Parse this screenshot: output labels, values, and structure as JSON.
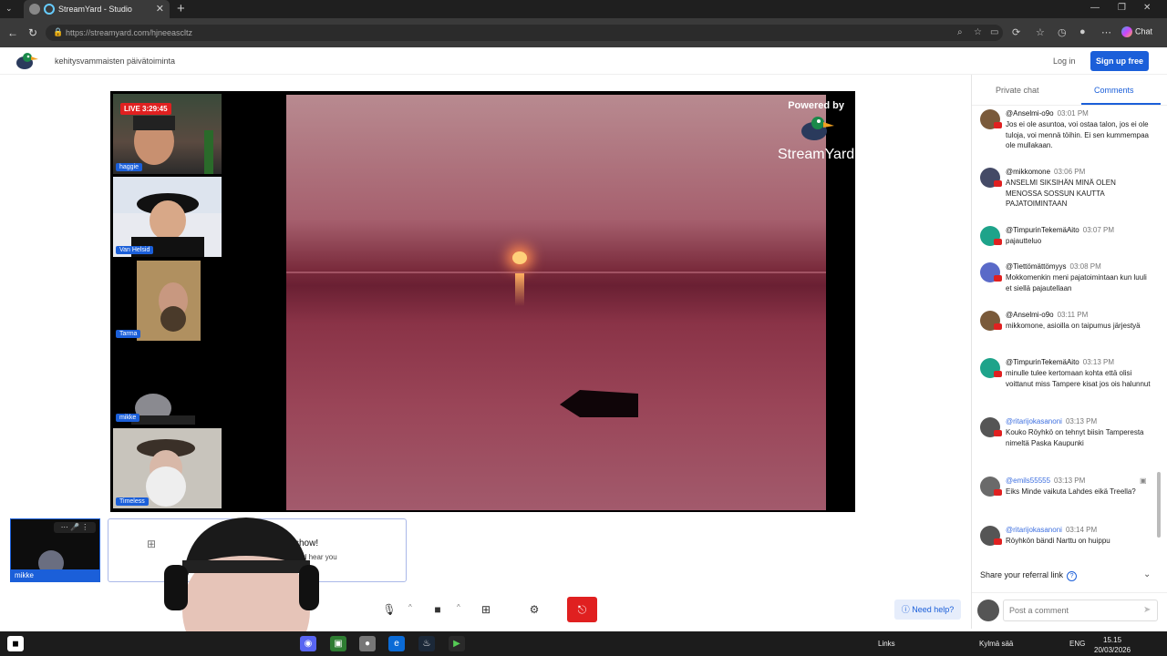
{
  "browser": {
    "tab_title": "StreamYard - Studio",
    "url": "https://streamyard.com/hjneeascltz",
    "chat_label": "Chat"
  },
  "header": {
    "title": "kehitysvammaisten päivätoiminta",
    "login": "Log in",
    "signup": "Sign up free"
  },
  "stage": {
    "live_badge": "LIVE 3:29:45",
    "cams": [
      {
        "name": "haggie"
      },
      {
        "name": "Van Helsid"
      },
      {
        "name": "Tarma"
      },
      {
        "name": "mikke"
      },
      {
        "name": "Timeless"
      }
    ],
    "powered_by": "Powered by",
    "brand": "StreamYard"
  },
  "selfcam": {
    "name": "mikke"
  },
  "prompt": {
    "title": "show!",
    "subtitle": "and hear you"
  },
  "controls": {
    "help": "Need help?"
  },
  "chat": {
    "tabs": [
      "Private chat",
      "Comments"
    ],
    "messages": [
      {
        "author": "@Anselmi-o9o",
        "time": "03:01 PM",
        "text": "Jos ei ole asuntoa, voi ostaa talon, jos ei ole tuloja, voi mennä töihin. Ei sen kummempaa ole mullakaan.",
        "avatar": "#7a5a3a",
        "mod": false
      },
      {
        "author": "@mikkomone",
        "time": "03:06 PM",
        "text": "ANSELMI SIKSIHÄN MINÄ OLEN MENOSSA SOSSUN KAUTTA PAJATOIMINTAAN",
        "avatar": "#444a66",
        "mod": false
      },
      {
        "author": "@TimpurinTekemäAito",
        "time": "03:07 PM",
        "text": "pajautteluo",
        "avatar": "#1ea38a",
        "mod": false
      },
      {
        "author": "@Tiettömättömyys",
        "time": "03:08 PM",
        "text": "Mokkomenkin meni pajatoimintaan kun luuli et siellä pajautellaan",
        "avatar": "#5a6ac8",
        "mod": false
      },
      {
        "author": "@Anselmi-o9o",
        "time": "03:11 PM",
        "text": "mikkomone, asioilla on taipumus järjestyä",
        "avatar": "#7a5a3a",
        "mod": false
      },
      {
        "author": "@TimpurinTekemäAito",
        "time": "03:13 PM",
        "text": "minulle tulee kertomaan kohta että olisi voittanut miss Tampere kisat jos ois halunnut",
        "avatar": "#1ea38a",
        "mod": false
      },
      {
        "author": "@ritarijokasanoni",
        "time": "03:13 PM",
        "text": "Kouko Röyhkö on tehnyt biisin Tamperesta nimeltä Paska Kaupunki",
        "avatar": "#555",
        "mod": true
      },
      {
        "author": "@emils55555",
        "time": "03:13 PM",
        "text": "Eiks Minde vaikuta Lahdes eikä Treella?",
        "avatar": "#6a6a6a",
        "mod": true
      },
      {
        "author": "@ritarijokasanoni",
        "time": "03:14 PM",
        "text": "Röyhkön bändi Narttu on huippu",
        "avatar": "#555",
        "mod": true
      }
    ],
    "referral": "Share your referral link",
    "comment_placeholder": "Post a comment"
  },
  "taskbar": {
    "links": "Links",
    "weather": "Kylmä sää",
    "lang": "ENG",
    "time": "15.15",
    "date": "20/03/2026"
  }
}
